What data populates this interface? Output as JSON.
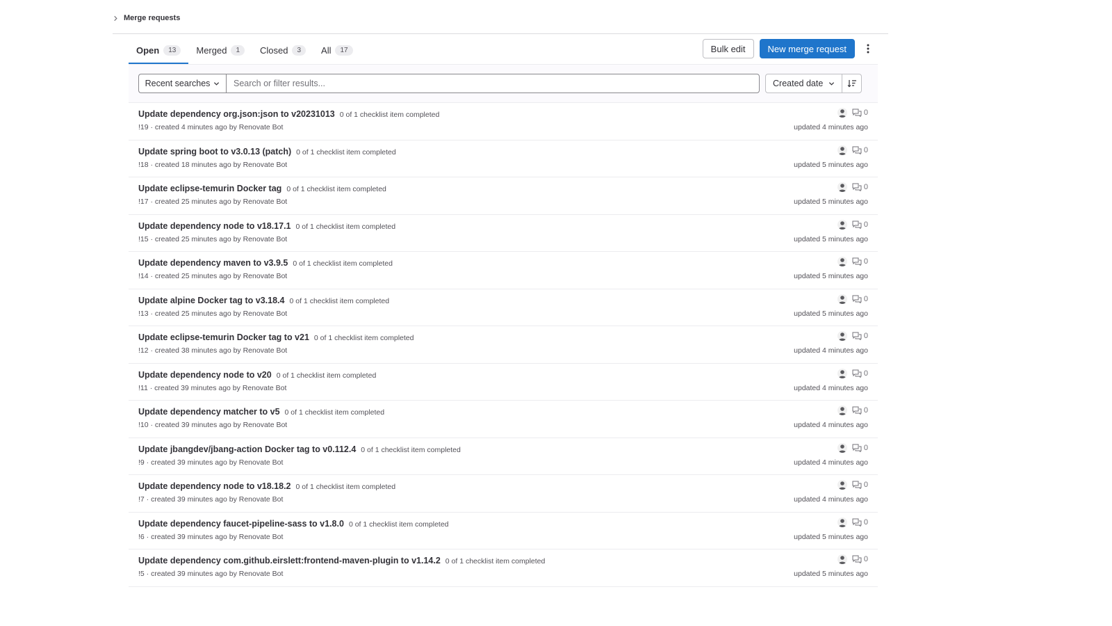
{
  "breadcrumb": {
    "label": "Merge requests"
  },
  "tabs": [
    {
      "label": "Open",
      "count": "13"
    },
    {
      "label": "Merged",
      "count": "1"
    },
    {
      "label": "Closed",
      "count": "3"
    },
    {
      "label": "All",
      "count": "17"
    }
  ],
  "actions": {
    "bulk_edit": "Bulk edit",
    "new_mr": "New merge request"
  },
  "filter": {
    "recent_searches": "Recent searches",
    "search_placeholder": "Search or filter results...",
    "sort_label": "Created date"
  },
  "merge_requests": [
    {
      "title": "Update dependency org.json:json to v20231013",
      "checklist": "0 of 1 checklist item completed",
      "meta": "!19 · created 4 minutes ago by ",
      "author": "Renovate Bot",
      "comments": "0",
      "updated": "updated 4 minutes ago"
    },
    {
      "title": "Update spring boot to v3.0.13 (patch)",
      "checklist": "0 of 1 checklist item completed",
      "meta": "!18 · created 18 minutes ago by ",
      "author": "Renovate Bot",
      "comments": "0",
      "updated": "updated 5 minutes ago"
    },
    {
      "title": "Update eclipse-temurin Docker tag",
      "checklist": "0 of 1 checklist item completed",
      "meta": "!17 · created 25 minutes ago by ",
      "author": "Renovate Bot",
      "comments": "0",
      "updated": "updated 5 minutes ago"
    },
    {
      "title": "Update dependency node to v18.17.1",
      "checklist": "0 of 1 checklist item completed",
      "meta": "!15 · created 25 minutes ago by ",
      "author": "Renovate Bot",
      "comments": "0",
      "updated": "updated 5 minutes ago"
    },
    {
      "title": "Update dependency maven to v3.9.5",
      "checklist": "0 of 1 checklist item completed",
      "meta": "!14 · created 25 minutes ago by ",
      "author": "Renovate Bot",
      "comments": "0",
      "updated": "updated 5 minutes ago"
    },
    {
      "title": "Update alpine Docker tag to v3.18.4",
      "checklist": "0 of 1 checklist item completed",
      "meta": "!13 · created 25 minutes ago by ",
      "author": "Renovate Bot",
      "comments": "0",
      "updated": "updated 5 minutes ago"
    },
    {
      "title": "Update eclipse-temurin Docker tag to v21",
      "checklist": "0 of 1 checklist item completed",
      "meta": "!12 · created 38 minutes ago by ",
      "author": "Renovate Bot",
      "comments": "0",
      "updated": "updated 4 minutes ago"
    },
    {
      "title": "Update dependency node to v20",
      "checklist": "0 of 1 checklist item completed",
      "meta": "!11 · created 39 minutes ago by ",
      "author": "Renovate Bot",
      "comments": "0",
      "updated": "updated 4 minutes ago"
    },
    {
      "title": "Update dependency matcher to v5",
      "checklist": "0 of 1 checklist item completed",
      "meta": "!10 · created 39 minutes ago by ",
      "author": "Renovate Bot",
      "comments": "0",
      "updated": "updated 4 minutes ago"
    },
    {
      "title": "Update jbangdev/jbang-action Docker tag to v0.112.4",
      "checklist": "0 of 1 checklist item completed",
      "meta": "!9 · created 39 minutes ago by ",
      "author": "Renovate Bot",
      "comments": "0",
      "updated": "updated 4 minutes ago"
    },
    {
      "title": "Update dependency node to v18.18.2",
      "checklist": "0 of 1 checklist item completed",
      "meta": "!7 · created 39 minutes ago by ",
      "author": "Renovate Bot",
      "comments": "0",
      "updated": "updated 4 minutes ago"
    },
    {
      "title": "Update dependency faucet-pipeline-sass to v1.8.0",
      "checklist": "0 of 1 checklist item completed",
      "meta": "!6 · created 39 minutes ago by ",
      "author": "Renovate Bot",
      "comments": "0",
      "updated": "updated 5 minutes ago"
    },
    {
      "title": "Update dependency com.github.eirslett:frontend-maven-plugin to v1.14.2",
      "checklist": "0 of 1 checklist item completed",
      "meta": "!5 · created 39 minutes ago by ",
      "author": "Renovate Bot",
      "comments": "0",
      "updated": "updated 5 minutes ago"
    }
  ],
  "icons": {
    "breadcrumb": "chevron-right-icon",
    "more": "ellipsis-v-icon",
    "dropdown": "chevron-down-icon",
    "sort_direction": "sort-lowest-icon",
    "avatar": "user-avatar-icon",
    "comments": "comments-icon"
  },
  "colors": {
    "primary": "#1f75cb",
    "text": "#333238",
    "muted": "#535158",
    "border": "#ececef",
    "filter_bg": "#fbfafd"
  }
}
